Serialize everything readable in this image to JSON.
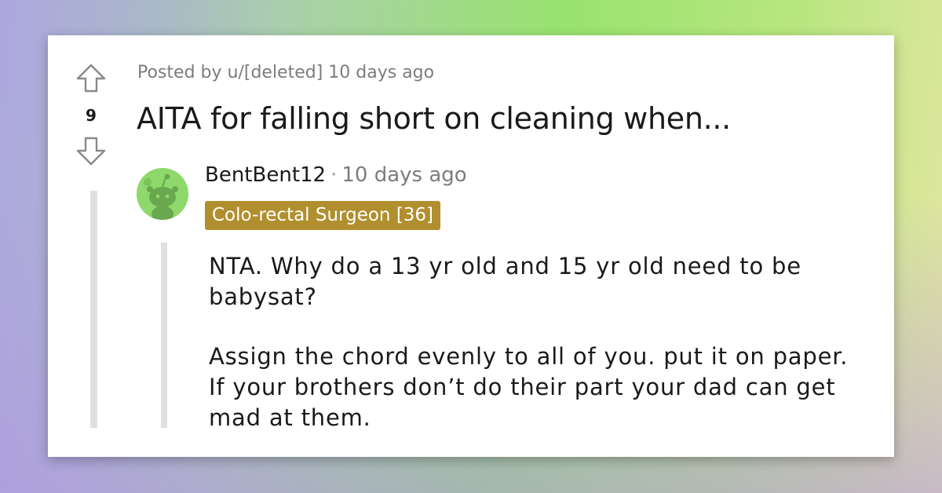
{
  "post": {
    "vote_count": "9",
    "meta": "Posted by u/[deleted] 10 days ago",
    "title": "AITA for falling short on cleaning when..."
  },
  "comment": {
    "author": "BentBent12",
    "separator": "·",
    "time": "10 days ago",
    "flair": "Colo-rectal Surgeon [36]",
    "paragraphs": [
      "NTA. Why do a 13 yr old and 15 yr old need to be babysat?",
      "Assign the chord evenly to all of you. put it on paper. If your brothers don’t do their part your dad can get mad at them."
    ]
  },
  "icons": {
    "upvote": "upvote-arrow-icon",
    "downvote": "downvote-arrow-icon",
    "avatar": "snoo-avatar-icon"
  },
  "colors": {
    "flair_bg": "#b18f2e",
    "avatar_bg": "#8fd86b",
    "text": "#1a1a1b",
    "meta_text": "#7c7c7c"
  }
}
